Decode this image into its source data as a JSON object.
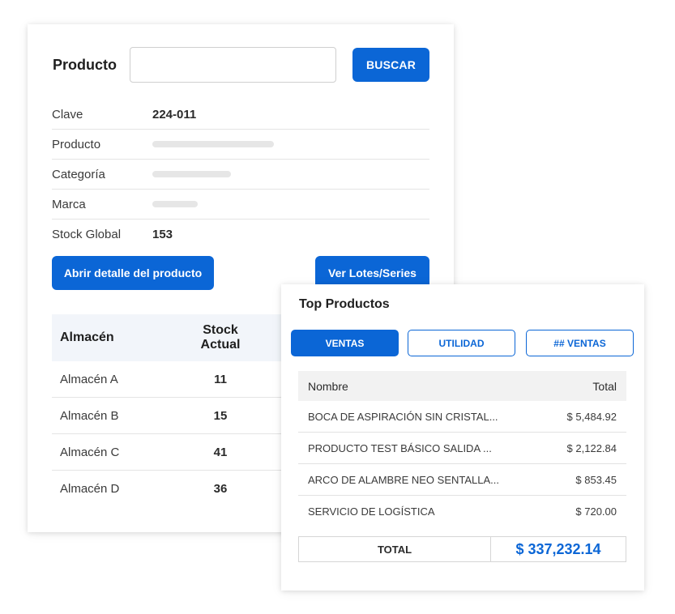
{
  "product_search": {
    "label": "Producto",
    "input_value": "",
    "search_button": "BUSCAR"
  },
  "product_info": [
    {
      "key": "Clave",
      "value": "224-011"
    },
    {
      "key": "Producto",
      "value": ""
    },
    {
      "key": "Categoría",
      "value": ""
    },
    {
      "key": "Marca",
      "value": ""
    },
    {
      "key": "Stock Global",
      "value": "153"
    }
  ],
  "actions": {
    "detail_button": "Abrir detalle del producto",
    "lots_button": "Ver Lotes/Series"
  },
  "stock_table": {
    "headers": [
      "Almacén",
      "Stock\nActual"
    ],
    "rows": [
      {
        "warehouse": "Almacén A",
        "stock": "11"
      },
      {
        "warehouse": "Almacén B",
        "stock": "15"
      },
      {
        "warehouse": "Almacén C",
        "stock": "41"
      },
      {
        "warehouse": "Almacén D",
        "stock": "36"
      }
    ]
  },
  "top_products": {
    "title": "Top Productos",
    "tabs": [
      {
        "label": "VENTAS",
        "active": true
      },
      {
        "label": "UTILIDAD",
        "active": false
      },
      {
        "label": "## VENTAS",
        "active": false
      }
    ],
    "headers": [
      "Nombre",
      "Total"
    ],
    "rows": [
      {
        "name": "BOCA DE ASPIRACIÓN SIN CRISTAL...",
        "total": "$ 5,484.92"
      },
      {
        "name": "PRODUCTO TEST BÁSICO  SALIDA ...",
        "total": "$ 2,122.84"
      },
      {
        "name": "ARCO DE ALAMBRE NEO SENTALLA...",
        "total": "$ 853.45"
      },
      {
        "name": "SERVICIO DE LOGÍSTICA",
        "total": "$ 720.00"
      }
    ],
    "total_label": "TOTAL",
    "total_value": "$ 337,232.14"
  },
  "colors": {
    "primary": "#0b66d6",
    "header_bg": "#f2f5fa",
    "table_head_bg": "#f2f2f2",
    "skeleton": "#e6e6e6"
  }
}
